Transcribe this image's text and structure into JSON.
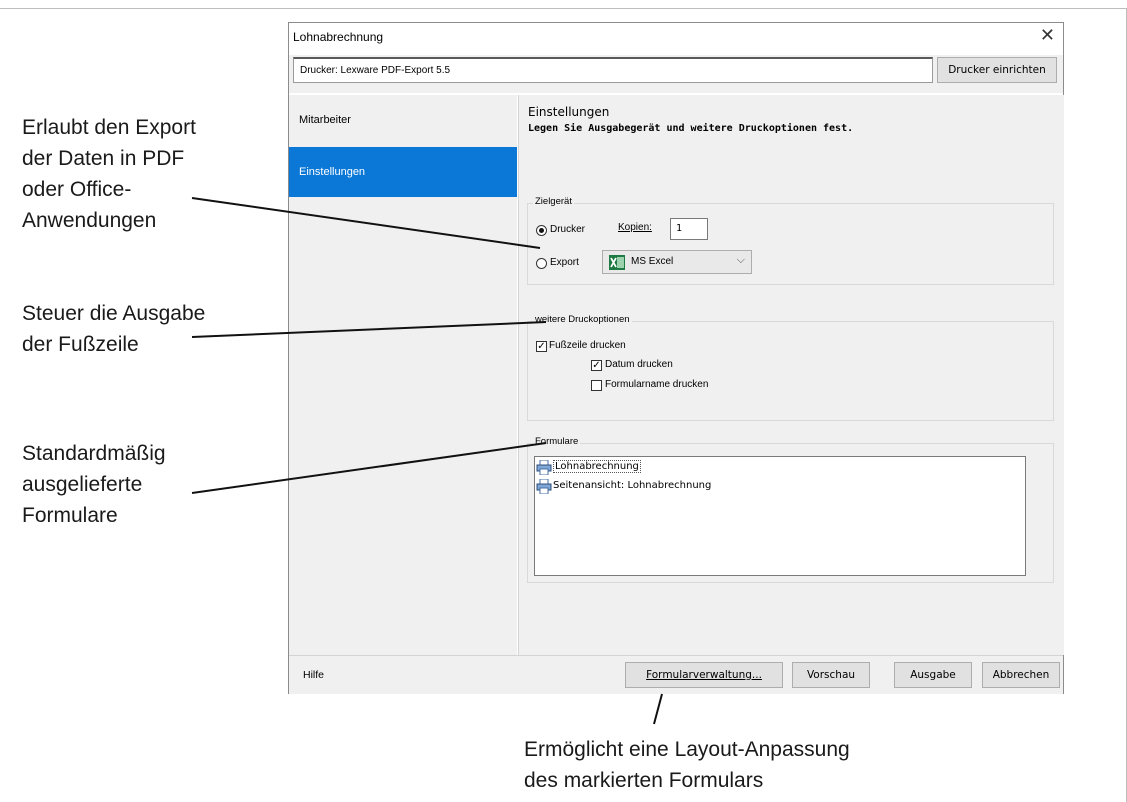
{
  "dialog": {
    "title": "Lohnabrechnung",
    "printer_label": "Drucker: Lexware PDF-Export 5.5",
    "setup_printer_button": "Drucker einrichten"
  },
  "sidebar": {
    "items": [
      {
        "label": "Mitarbeiter",
        "active": false
      },
      {
        "label": "Einstellungen",
        "active": true
      }
    ]
  },
  "main": {
    "heading": "Einstellungen",
    "subheading": "Legen Sie Ausgabegerät und weitere Druckoptionen fest."
  },
  "zielgeraet": {
    "group_label": "Zielgerät",
    "radio_printer": "Drucker",
    "radio_printer_selected": true,
    "copies_label": "Kopien:",
    "copies_value": "1",
    "radio_export": "Export",
    "radio_export_selected": false,
    "export_format": "MS Excel"
  },
  "druckoptionen": {
    "group_label": "weitere Druckoptionen",
    "footer_print": {
      "label": "Fußzeile drucken",
      "checked": true
    },
    "date_print": {
      "label": "Datum drucken",
      "checked": true
    },
    "formname_print": {
      "label": "Formularname drucken",
      "checked": false
    }
  },
  "formulare": {
    "group_label": "Formulare",
    "items": [
      {
        "label": "Lohnabrechnung",
        "selected": true
      },
      {
        "label": "Seitenansicht: Lohnabrechnung",
        "selected": false
      }
    ]
  },
  "footer": {
    "help": "Hilfe",
    "buttons": {
      "form_management": "Formularverwaltung...",
      "preview": "Vorschau",
      "output": "Ausgabe",
      "cancel": "Abbrechen"
    }
  },
  "callouts": {
    "export": [
      "Erlaubt den Export",
      "der Daten in PDF",
      "oder Office-",
      "Anwendungen"
    ],
    "footer": [
      "Steuer die Ausgabe",
      "der Fußzeile"
    ],
    "forms": [
      "Standardmäßig",
      "ausgelieferte",
      "Formulare"
    ],
    "layout": [
      "Ermöglicht eine Layout-Anpassung",
      "des markierten Formulars"
    ]
  },
  "colors": {
    "accent": "#0b78d7",
    "panel": "#f0f0f0",
    "excel_green": "#1d7a43"
  }
}
